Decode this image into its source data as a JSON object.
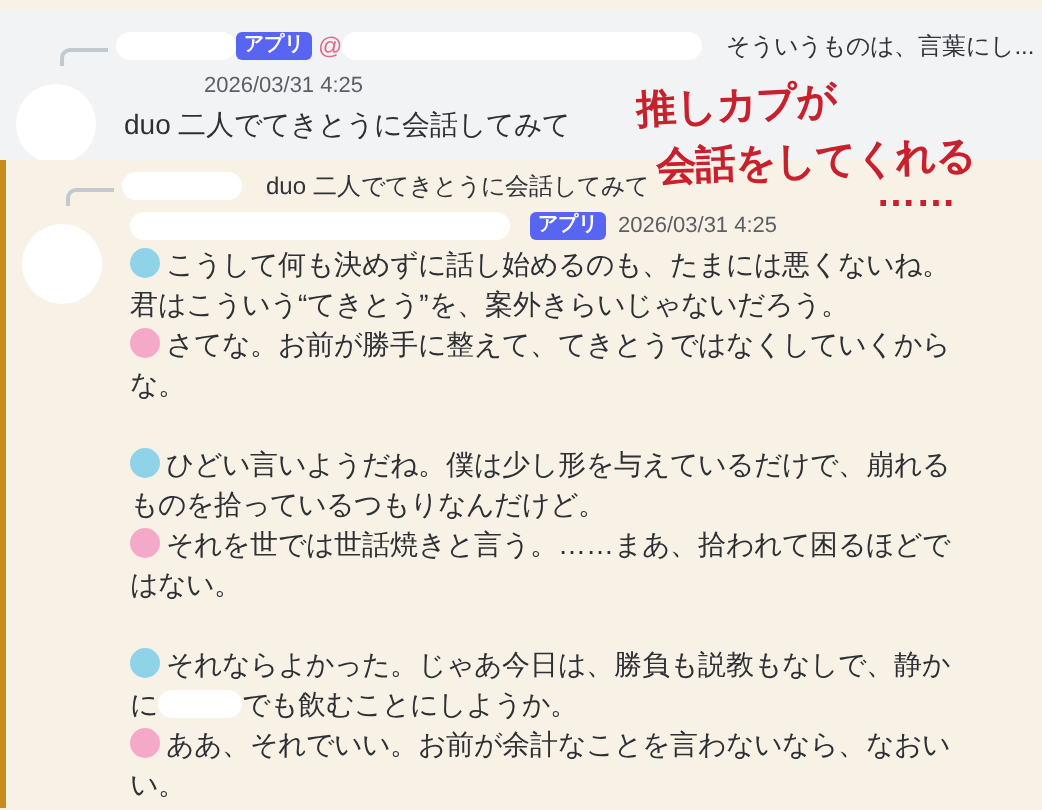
{
  "messages": [
    {
      "reply": {
        "badge": "アプリ",
        "mention": "@",
        "text": "そういうものは、言葉にし..."
      },
      "timestamp": "2026/03/31 4:25",
      "highlighted": false,
      "lines": [
        {
          "kind": "plain",
          "segments": [
            "duo 二人でてきとうに会話してみて"
          ]
        }
      ]
    },
    {
      "reply": {
        "text": "duo 二人でてきとうに会話してみて"
      },
      "badge": "アプリ",
      "timestamp": "2026/03/31 4:25",
      "highlighted": true,
      "lines": [
        {
          "kind": "speech",
          "color": "#8fd3e8",
          "segments": [
            "こうして何も決めずに話し始めるのも、たまには悪くないね。"
          ]
        },
        {
          "kind": "plain",
          "segments": [
            "君はこういう“てきとう”を、案外きらいじゃないだろう。"
          ]
        },
        {
          "kind": "speech",
          "color": "#f5a9c8",
          "segments": [
            "さてな。お前が勝手に整えて、てきとうではなくしていくからな。"
          ]
        },
        {
          "kind": "blank"
        },
        {
          "kind": "speech",
          "color": "#8fd3e8",
          "segments": [
            "ひどい言いようだね。僕は少し形を与えているだけで、崩れるものを拾っているつもりなんだけど。"
          ]
        },
        {
          "kind": "speech",
          "color": "#f5a9c8",
          "segments": [
            "それを世では世話焼きと言う。……まあ、拾われて困るほどではない。"
          ]
        },
        {
          "kind": "blank"
        },
        {
          "kind": "speech",
          "color": "#8fd3e8",
          "segments": [
            "それならよかった。じゃあ今日は、勝負も説教もなしで、静かに",
            "でも飲むことにしようか。"
          ]
        },
        {
          "kind": "speech",
          "color": "#f5a9c8",
          "segments": [
            "ああ、それでいい。お前が余計なことを言わないなら、なおいい。"
          ]
        }
      ]
    }
  ],
  "annotation": {
    "lines": [
      "推しカプが",
      "会話をしてくれる",
      "……"
    ]
  }
}
